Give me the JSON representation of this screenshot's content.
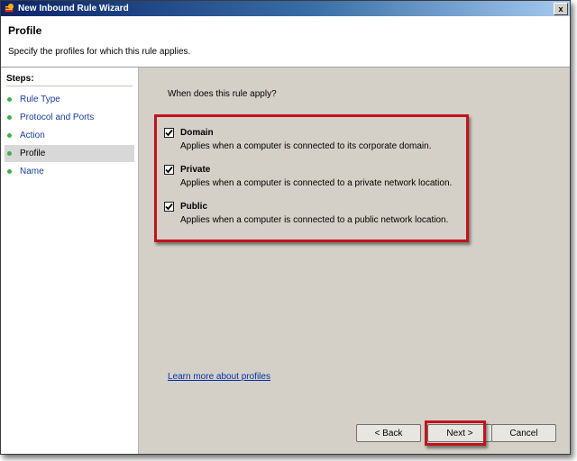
{
  "window": {
    "title": "New Inbound Rule Wizard",
    "close_label": "x"
  },
  "header": {
    "title": "Profile",
    "subtitle": "Specify the profiles for which this rule applies."
  },
  "steps": {
    "title": "Steps:",
    "items": [
      {
        "label": "Rule Type"
      },
      {
        "label": "Protocol and Ports"
      },
      {
        "label": "Action"
      },
      {
        "label": "Profile"
      },
      {
        "label": "Name"
      }
    ],
    "active": "Profile"
  },
  "content": {
    "question": "When does this rule apply?",
    "options": [
      {
        "label": "Domain",
        "checked": true,
        "description": "Applies when a computer is connected to its corporate domain."
      },
      {
        "label": "Private",
        "checked": true,
        "description": "Applies when a computer is connected to a private network location."
      },
      {
        "label": "Public",
        "checked": true,
        "description": "Applies when a computer is connected to a public network location."
      }
    ],
    "learn_more": "Learn more about profiles"
  },
  "buttons": {
    "back": "< Back",
    "next": "Next >",
    "cancel": "Cancel"
  },
  "colors": {
    "highlight": "#c0141c",
    "link": "#0033aa",
    "step_bullet": "#3cb044",
    "title_bar": "#0a246a"
  }
}
